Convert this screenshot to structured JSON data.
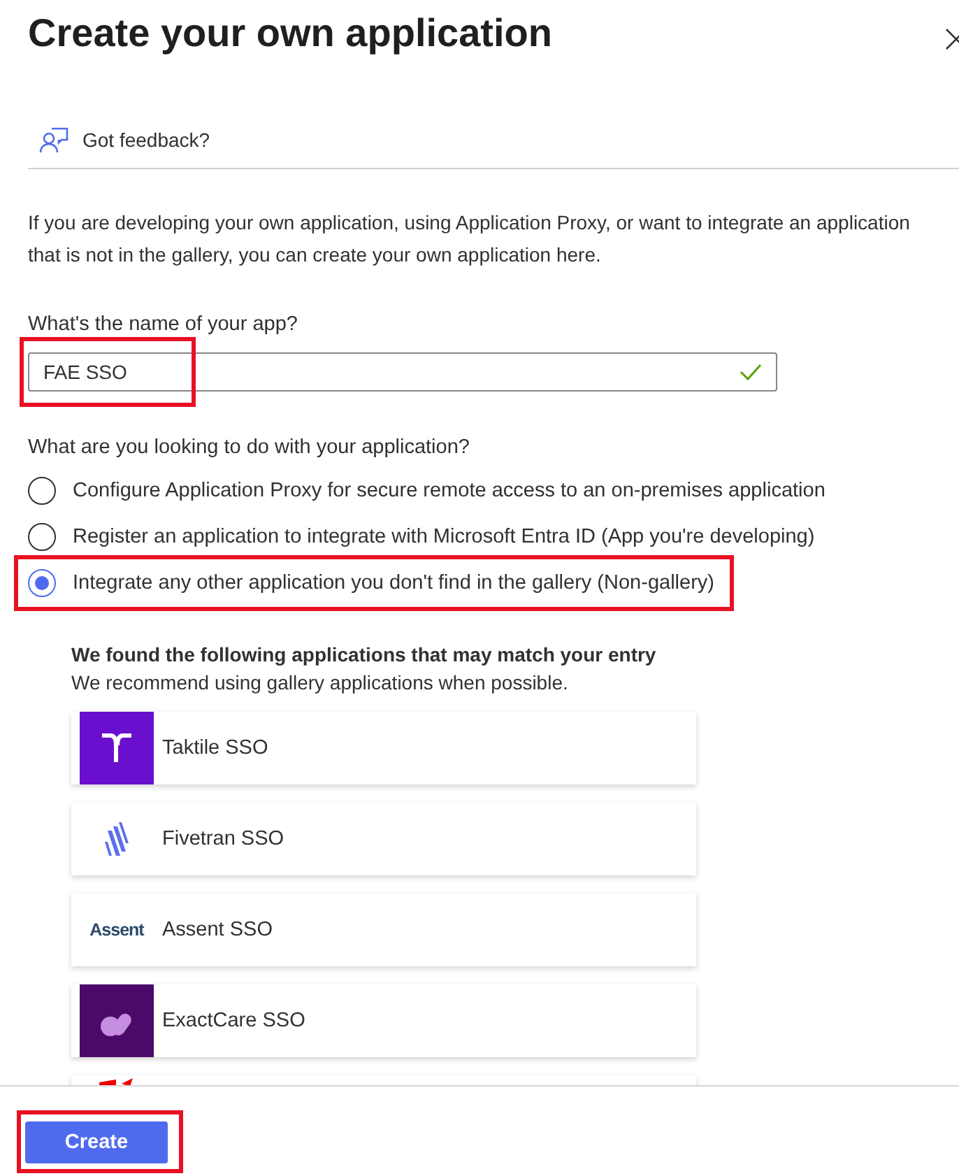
{
  "title": "Create your own application",
  "feedback": "Got feedback?",
  "intro": "If you are developing your own application, using Application Proxy, or want to integrate an application that is not in the gallery, you can create your own application here.",
  "name_field": {
    "label": "What's the name of your app?",
    "value": "FAE SSO",
    "valid": true,
    "highlighted": true
  },
  "question": "What are you looking to do with your application?",
  "options": [
    {
      "label": "Configure Application Proxy for secure remote access to an on-premises application",
      "selected": false
    },
    {
      "label": "Register an application to integrate with Microsoft Entra ID (App you're developing)",
      "selected": false
    },
    {
      "label": "Integrate any other application you don't find in the gallery (Non-gallery)",
      "selected": true,
      "highlighted": true
    }
  ],
  "matches": {
    "heading": "We found the following applications that may match your entry",
    "subheading": "We recommend using gallery applications when possible.",
    "items": [
      {
        "kind": "taktile",
        "name": "Taktile SSO"
      },
      {
        "kind": "fivetran",
        "name": "Fivetran SSO"
      },
      {
        "kind": "assent",
        "logo_text": "Assent",
        "name": "Assent SSO"
      },
      {
        "kind": "exactcare",
        "name": "ExactCare SSO"
      },
      {
        "kind": "red"
      }
    ]
  },
  "create_button": {
    "label": "Create",
    "highlighted": true
  }
}
